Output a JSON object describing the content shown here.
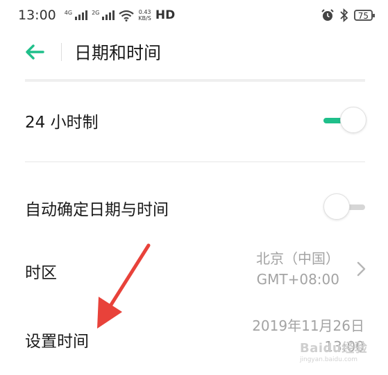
{
  "status": {
    "time": "13:00",
    "sig1_label": "4G",
    "sig2_label": "2G",
    "speed_value": "0.43",
    "speed_unit": "KB/S",
    "hd": "HD",
    "battery": "75"
  },
  "header": {
    "title": "日期和时间"
  },
  "settings": {
    "hour24": {
      "label": "24 小时制",
      "on": true
    },
    "auto": {
      "label": "自动确定日期与时间",
      "on": false
    },
    "timezone": {
      "label": "时区",
      "city": "北京（中国）",
      "gmt": "GMT+08:00"
    },
    "set_time": {
      "label": "设置时间",
      "date": "2019年11月26日",
      "time": "13:00"
    }
  },
  "watermark": {
    "main": "Baidu经验",
    "sub": "jingyan.baidu.com"
  },
  "colors": {
    "accent": "#1fbf8a",
    "off_track": "#d6d6d6",
    "arrow": "#e8423a"
  }
}
